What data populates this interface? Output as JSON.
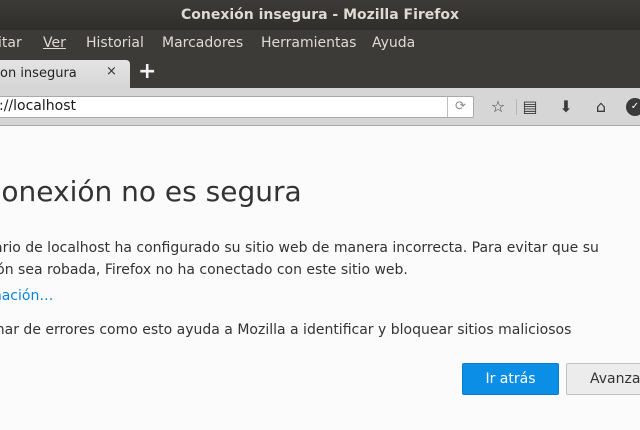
{
  "window": {
    "title": "Conexión insegura - Mozilla Firefox"
  },
  "menubar": {
    "items": [
      "itar",
      "Ver",
      "Historial",
      "Marcadores",
      "Herramientas",
      "Ayuda"
    ]
  },
  "tab": {
    "title": "on insegura",
    "close": "×",
    "new_tab": "+"
  },
  "navbar": {
    "url": "://localhost",
    "reload_icon": "reload-icon",
    "icons": [
      "bookmark-star-icon",
      "reading-list-icon",
      "download-icon",
      "home-icon",
      "pocket-icon"
    ]
  },
  "page": {
    "heading": "conexión no es segura",
    "desc_line1": "ietario de localhost ha configurado su sitio web de manera incorrecta. Para evitar que su",
    "desc_line2": "ación sea robada, Firefox no ha conectado con este sitio web.",
    "more_link": "ormación…",
    "report_text": "formar de errores como esto ayuda a Mozilla a identificar y bloquear sitios maliciosos",
    "back_button": "Ir atrás",
    "advanced_button": "Avanzado"
  },
  "colors": {
    "titlebar": "#3c3b37",
    "primary_button": "#0b8ee6",
    "link": "#0a84d8"
  }
}
